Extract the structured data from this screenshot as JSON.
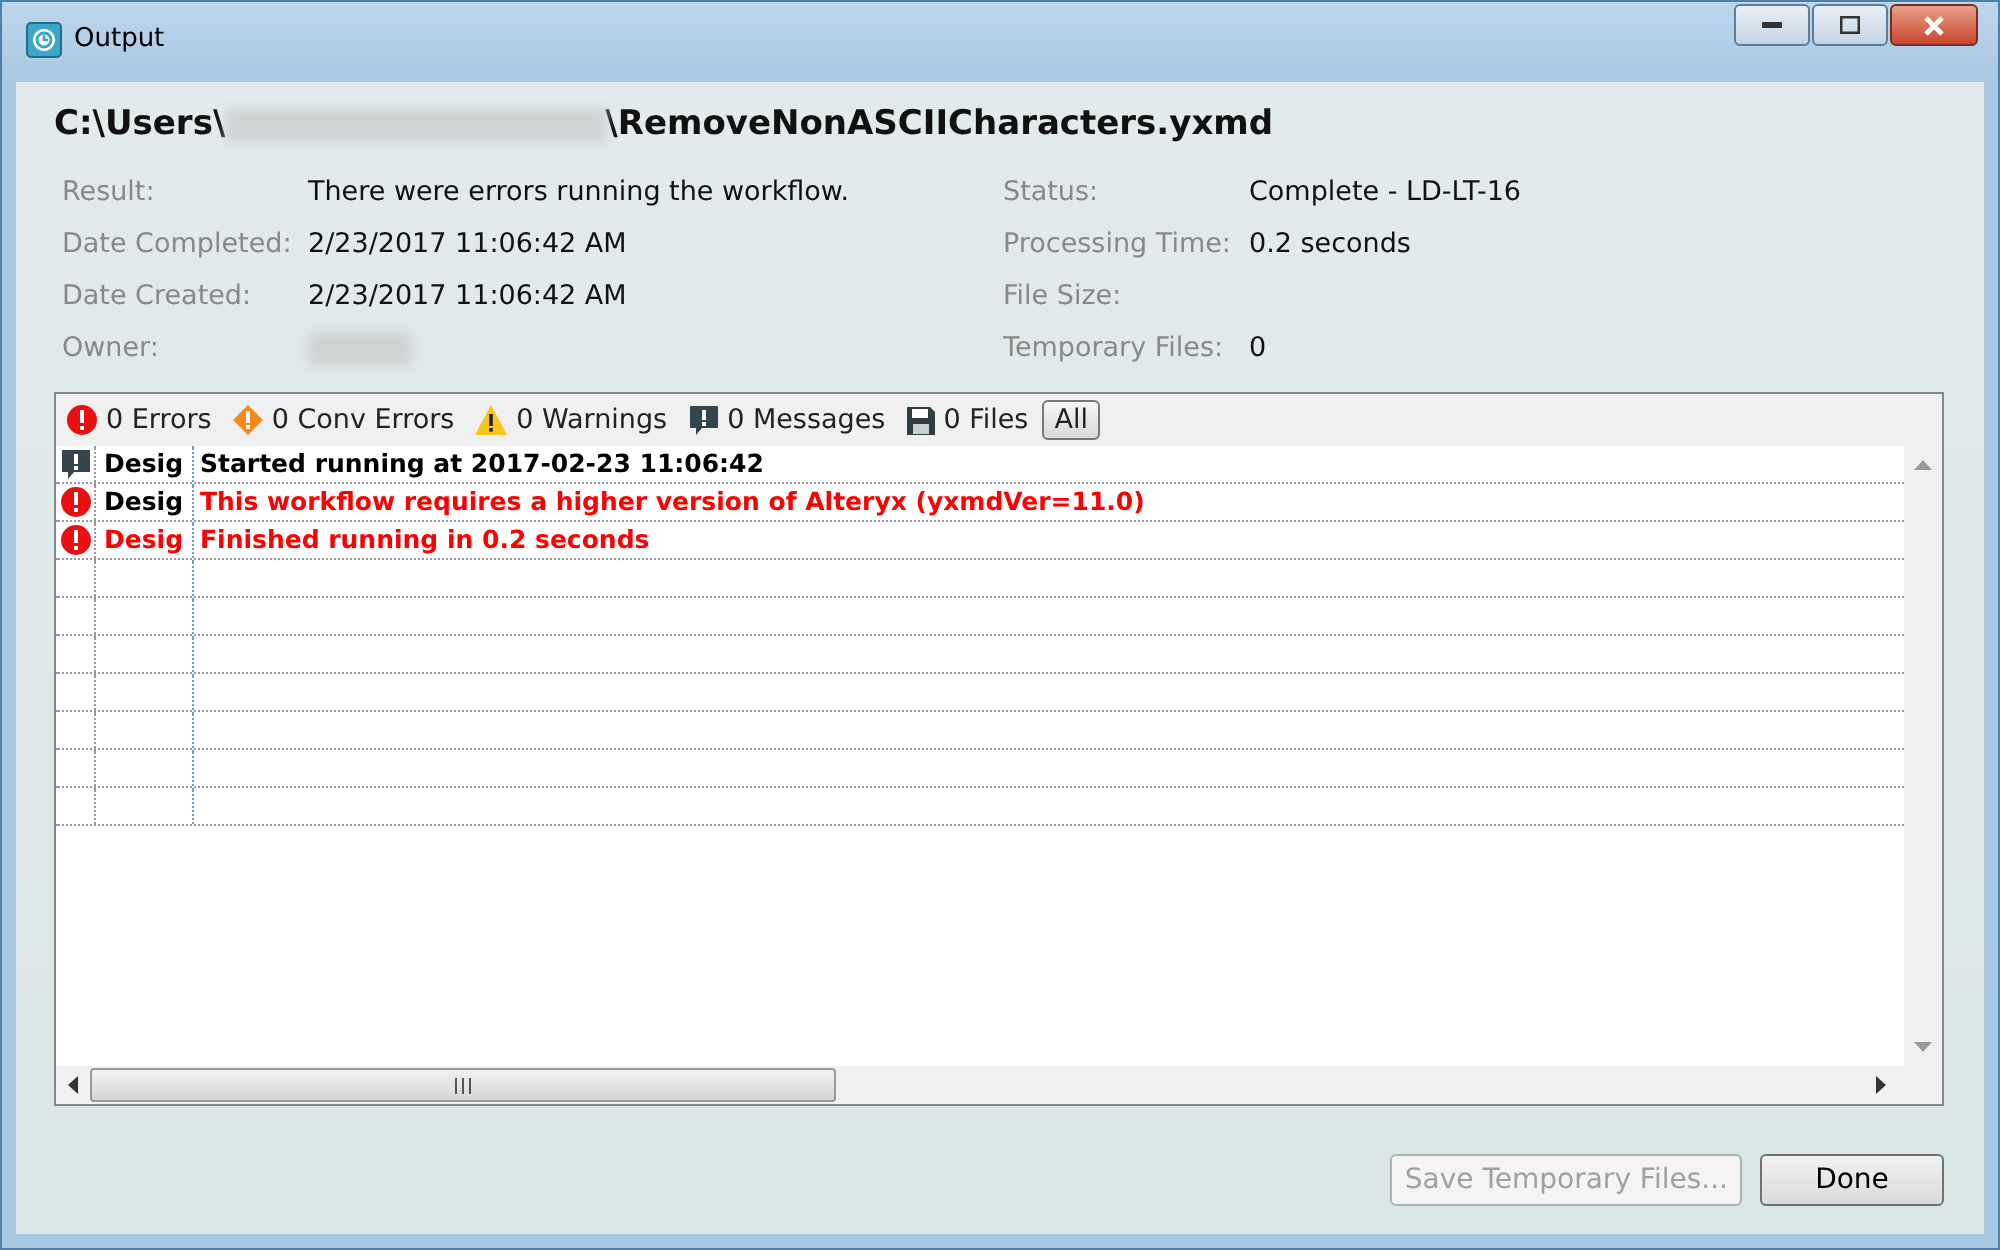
{
  "window": {
    "title": "Output"
  },
  "path": {
    "prefix": "C:\\Users\\",
    "suffix": "\\RemoveNonASCIICharacters.yxmd"
  },
  "details_left": [
    {
      "label": "Result:",
      "value": "There were errors running the workflow."
    },
    {
      "label": "Date Completed:",
      "value": "2/23/2017 11:06:42 AM"
    },
    {
      "label": "Date Created:",
      "value": "2/23/2017 11:06:42 AM"
    },
    {
      "label": "Owner:",
      "redacted": true
    }
  ],
  "details_right": [
    {
      "label": "Status:",
      "value": "Complete - LD-LT-16"
    },
    {
      "label": "Processing Time:",
      "value": "0.2 seconds"
    },
    {
      "label": "File Size:"
    },
    {
      "label": "Temporary Files:",
      "value": "0"
    }
  ],
  "filters": [
    {
      "kind": "error",
      "label": "0 Errors",
      "selected": false
    },
    {
      "kind": "conv_error",
      "label": "0 Conv Errors",
      "selected": false
    },
    {
      "kind": "warning",
      "label": "0 Warnings",
      "selected": false
    },
    {
      "kind": "message",
      "label": "0 Messages",
      "selected": false
    },
    {
      "kind": "file",
      "label": "0 Files",
      "selected": false
    },
    {
      "kind": "all",
      "label": "All",
      "selected": true
    }
  ],
  "messages": [
    {
      "kind": "message",
      "tool": "Desig",
      "tool_error": false,
      "text": "Started running at 2017-02-23 11:06:42",
      "text_error": false
    },
    {
      "kind": "error",
      "tool": "Desig",
      "tool_error": false,
      "text": "This workflow requires a higher version of Alteryx (yxmdVer=11.0)",
      "text_error": true
    },
    {
      "kind": "error",
      "tool": "Desig",
      "tool_error": true,
      "text": "Finished running in 0.2 seconds",
      "text_error": true
    }
  ],
  "buttons": [
    {
      "label": "Save Temporary Files...",
      "disabled": true
    },
    {
      "label": "Done",
      "disabled": false
    }
  ]
}
